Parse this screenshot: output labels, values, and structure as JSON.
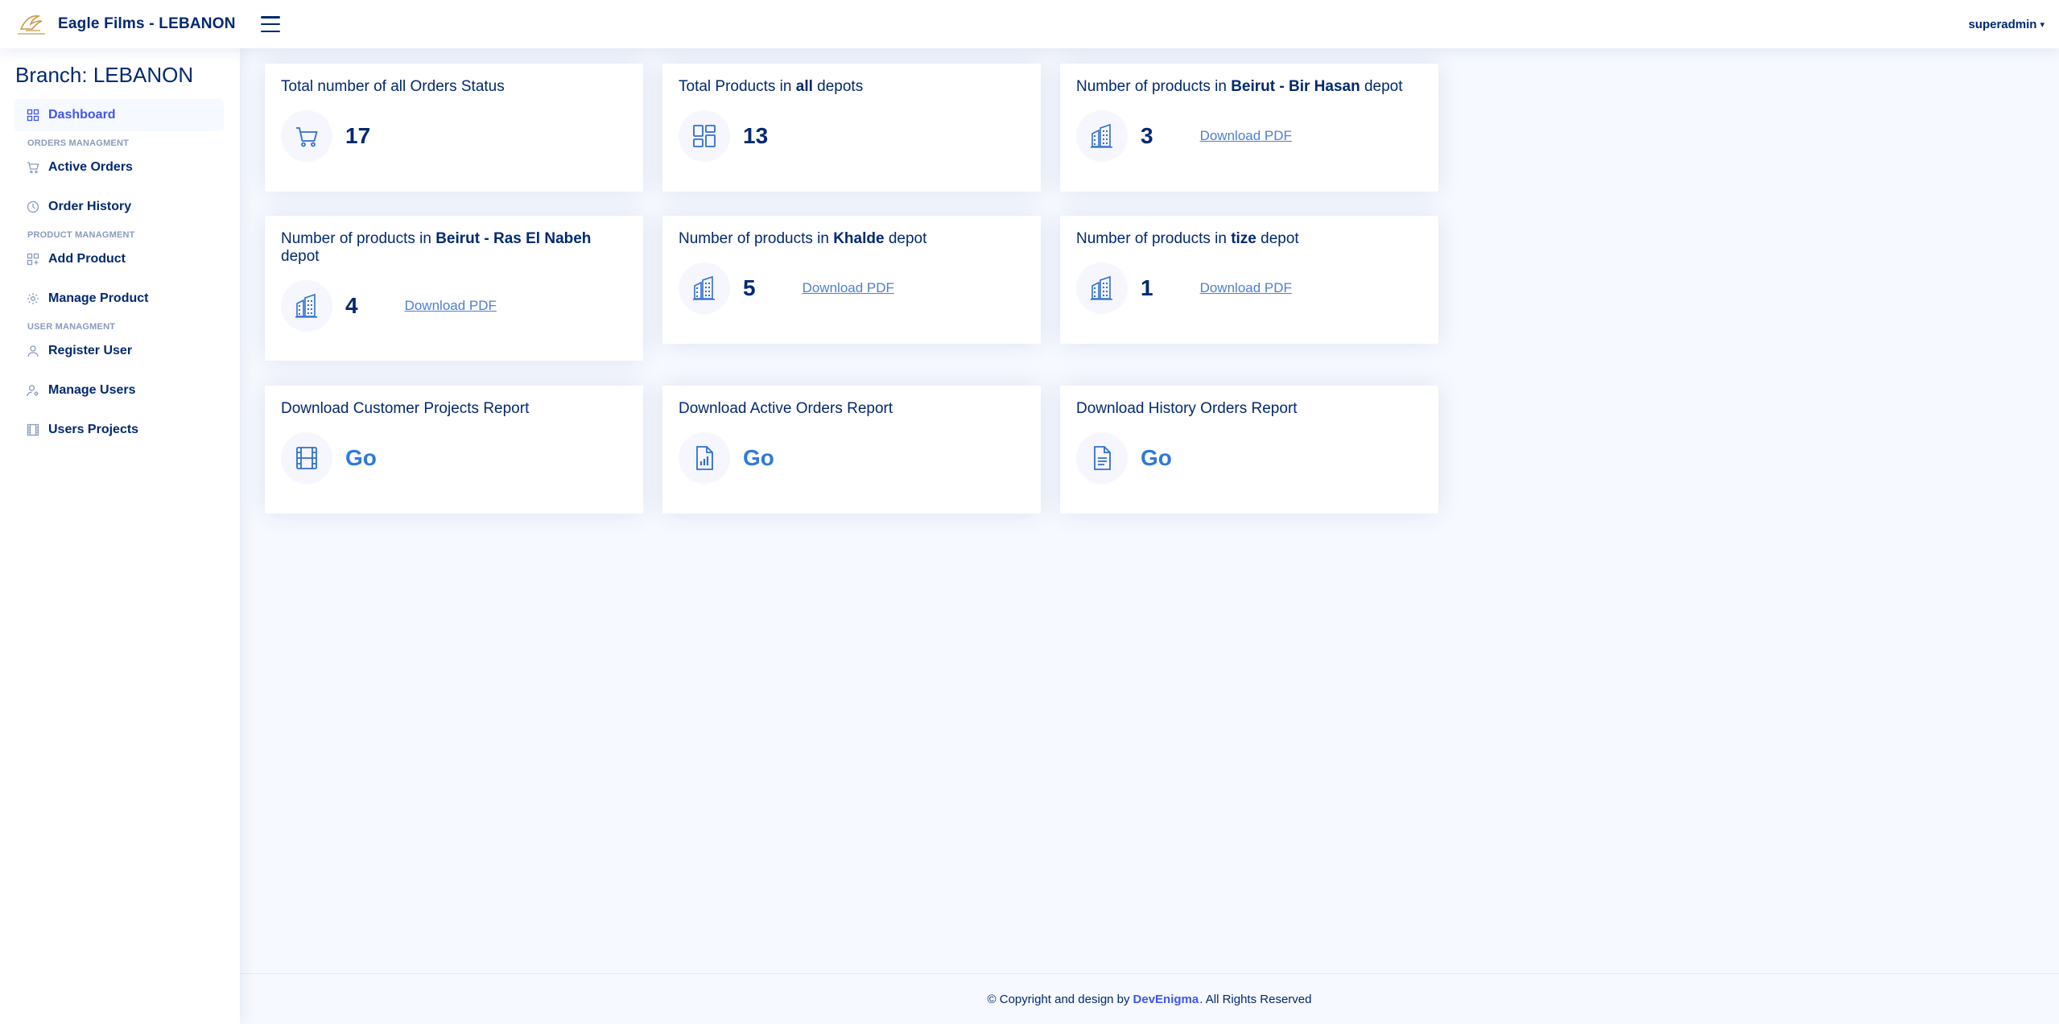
{
  "header": {
    "app_title": "Eagle Films - LEBANON",
    "user": "superadmin"
  },
  "sidebar": {
    "branch": "Branch: LEBANON",
    "items": {
      "dashboard": "Dashboard",
      "orders_heading": "ORDERS MANAGMENT",
      "active_orders": "Active Orders",
      "order_history": "Order History",
      "product_heading": "PRODUCT MANAGMENT",
      "add_product": "Add Product",
      "manage_product": "Manage Product",
      "user_heading": "USER MANAGMENT",
      "register_user": "Register User",
      "manage_users": "Manage Users",
      "users_projects": "Users Projects"
    }
  },
  "cards": {
    "orders": {
      "title": "Total number of all Orders Status",
      "count": "17"
    },
    "all_products": {
      "title_pre": "Total Products in ",
      "title_bold": "all",
      "title_post": " depots",
      "count": "13"
    },
    "bir_hasan": {
      "title_pre": "Number of products in ",
      "title_bold": "Beirut - Bir Hasan",
      "title_post": " depot",
      "count": "3",
      "link": "Download PDF"
    },
    "ras_el_nabeh": {
      "title_pre": "Number of products in ",
      "title_bold": "Beirut - Ras El Nabeh",
      "title_post": " depot",
      "count": "4",
      "link": "Download PDF"
    },
    "khalde": {
      "title_pre": "Number of products in ",
      "title_bold": "Khalde",
      "title_post": " depot",
      "count": "5",
      "link": "Download PDF"
    },
    "tize": {
      "title_pre": "Number of products in ",
      "title_bold": "tize",
      "title_post": " depot",
      "count": "1",
      "link": "Download PDF"
    },
    "customer_projects": {
      "title": "Download Customer Projects Report",
      "link": "Go"
    },
    "active_orders_report": {
      "title": "Download Active Orders Report",
      "link": "Go"
    },
    "history_orders_report": {
      "title": "Download History Orders Report",
      "link": "Go"
    }
  },
  "footer": {
    "pre": "© Copyright and design by",
    "brand": "DevEnigma",
    "post": ". All Rights Reserved"
  },
  "colors": {
    "primary": "#4154f1",
    "text": "#012970",
    "background": "#f6f9ff",
    "link": "#4d7fd1",
    "icon": "#2f6fd0"
  }
}
